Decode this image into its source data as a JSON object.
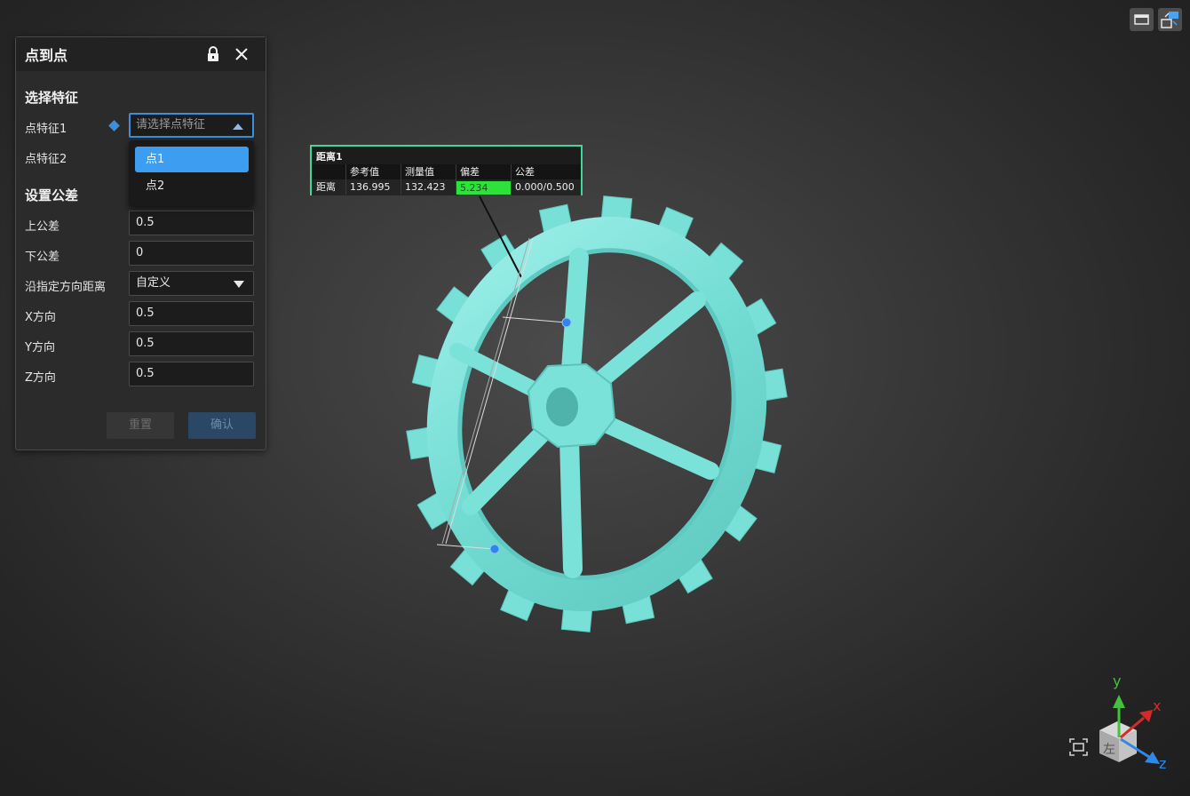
{
  "panel": {
    "title": "点到点",
    "section_select": "选择特征",
    "point_feature_1": {
      "label": "点特征1",
      "placeholder": "请选择点特征"
    },
    "point_feature_2": {
      "label": "点特征2"
    },
    "dropdown_options": [
      "点1",
      "点2"
    ],
    "section_tolerance": "设置公差",
    "upper_tol": {
      "label": "上公差",
      "value": "0.5"
    },
    "lower_tol": {
      "label": "下公差",
      "value": "0"
    },
    "direction": {
      "label": "沿指定方向距离",
      "value": "自定义"
    },
    "x_dir": {
      "label": "X方向",
      "value": "0.5"
    },
    "y_dir": {
      "label": "Y方向",
      "value": "0.5"
    },
    "z_dir": {
      "label": "Z方向",
      "value": "0.5"
    },
    "reset_label": "重置",
    "confirm_label": "确认"
  },
  "measurement": {
    "title": "距离1",
    "headers": [
      "参考值",
      "测量值",
      "偏差",
      "公差"
    ],
    "row_label": "距离",
    "reference": "136.995",
    "measured": "132.423",
    "deviation": "5.234",
    "tolerance": "0.000/0.500"
  },
  "axis": {
    "x": "x",
    "y": "y",
    "z": "z",
    "cube_face": "左"
  },
  "colors": {
    "accent": "#3b8fdc",
    "model": "#7fe5dc",
    "deviation_ok": "#2de23a",
    "frame": "#3fd79a"
  }
}
